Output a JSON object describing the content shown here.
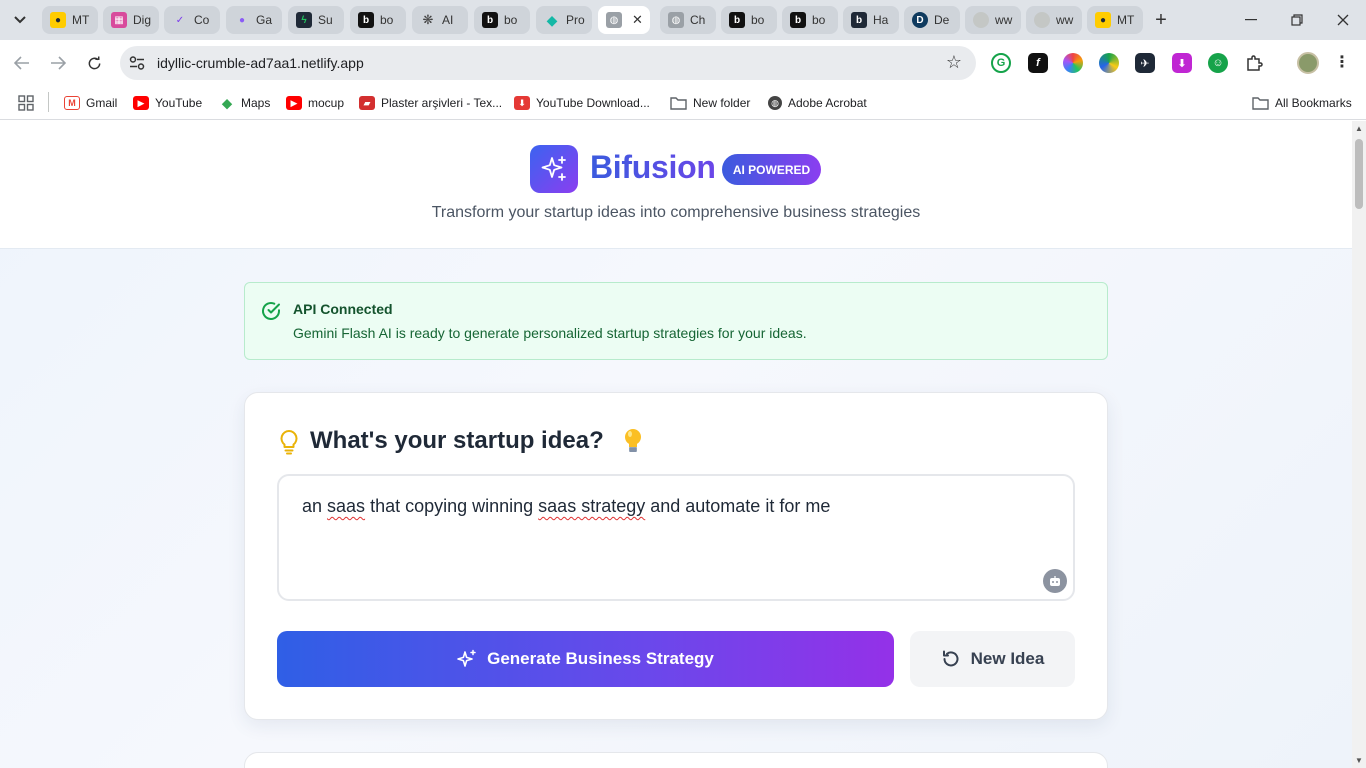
{
  "browser": {
    "tabs": [
      {
        "label": "MT",
        "favicon": "mtn-icon",
        "color": "#ffcc00"
      },
      {
        "label": "Dig",
        "favicon": "grid-colorful-icon",
        "color": "#d84a9c"
      },
      {
        "label": "Co",
        "favicon": "check-purple-icon",
        "color": "#7c3aed"
      },
      {
        "label": "Ga",
        "favicon": "circle-purple-icon",
        "color": "#8b5cf6"
      },
      {
        "label": "Su",
        "favicon": "bolt-green-icon",
        "color": "#1f2937"
      },
      {
        "label": "bo",
        "favicon": "b-icon",
        "color": "#111111"
      },
      {
        "label": "AI",
        "favicon": "openai-icon",
        "color": "#444444"
      },
      {
        "label": "bo",
        "favicon": "b-icon",
        "color": "#111111"
      },
      {
        "label": "Pro",
        "favicon": "diamond-teal-icon",
        "color": "#14b8a6"
      },
      {
        "label": "",
        "favicon": "globe-icon",
        "color": "#9aa0a6",
        "active": true
      },
      {
        "label": "Ch",
        "favicon": "globe-icon",
        "color": "#9aa0a6"
      },
      {
        "label": "bo",
        "favicon": "b-icon",
        "color": "#111111"
      },
      {
        "label": "bo",
        "favicon": "b-icon",
        "color": "#111111"
      },
      {
        "label": "Ha",
        "favicon": "b-dark-icon",
        "color": "#1f2937"
      },
      {
        "label": "De",
        "favicon": "d-icon",
        "color": "#0f3b5f"
      },
      {
        "label": "ww",
        "favicon": "globe-icon",
        "color": "#c4c7c5"
      },
      {
        "label": "ww",
        "favicon": "globe-icon",
        "color": "#c4c7c5"
      },
      {
        "label": "MT",
        "favicon": "mtn-icon",
        "color": "#ffcc00"
      }
    ],
    "active_tab_close": "✕",
    "new_tab": "+",
    "url": "idyllic-crumble-ad7aa1.netlify.app",
    "bookmarks": [
      {
        "label": "Gmail",
        "icon": "gmail-icon",
        "color": "#ea4335"
      },
      {
        "label": "YouTube",
        "icon": "youtube-icon",
        "color": "#ff0000"
      },
      {
        "label": "Maps",
        "icon": "maps-icon",
        "color": "#34a853"
      },
      {
        "label": "mocup",
        "icon": "youtube-icon",
        "color": "#ff0000"
      },
      {
        "label": "Plaster arşivleri - Tex...",
        "icon": "plaster-icon",
        "color": "#d32f2f"
      },
      {
        "label": "YouTube Download...",
        "icon": "download-icon",
        "color": "#e53935"
      },
      {
        "label": "New folder",
        "icon": "folder-icon",
        "color": "#5f6368"
      },
      {
        "label": "Adobe Acrobat",
        "icon": "globe-icon",
        "color": "#444444"
      }
    ],
    "all_bookmarks": "All Bookmarks"
  },
  "site": {
    "brand": "Bifusion",
    "badge": "AI POWERED",
    "tagline": "Transform your startup ideas into comprehensive business strategies",
    "api_status": {
      "title": "API Connected",
      "description": "Gemini Flash AI is ready to generate personalized startup strategies for your ideas."
    },
    "idea_section": {
      "title": "What's your startup idea?",
      "input_parts": [
        "an ",
        "saas",
        " that copying winning ",
        "saas strategy",
        " and automate it for me"
      ],
      "generate_label": "Generate Business Strategy",
      "new_idea_label": "New Idea"
    }
  },
  "colors": {
    "brand_gradient_start": "#3b5bde",
    "brand_gradient_end": "#8b3ef0",
    "success_bg": "#ecfdf3",
    "success_text": "#166534"
  }
}
